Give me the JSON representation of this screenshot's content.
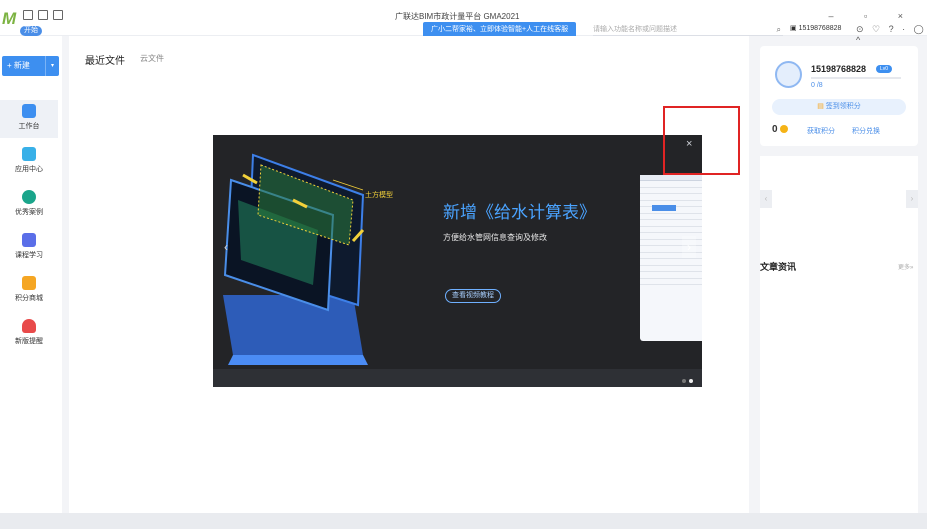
{
  "titlebar": {
    "logo_badge": "开始",
    "app_title": "广联达BIM市政计量平台 GMA2021",
    "promo": "广小二帮家裕、立即体验智能+人工在线客服",
    "search_placeholder": "请输入功能名称或问题描述",
    "user_phone": "15198768828",
    "window_controls": "– ▫ ×",
    "tool_icons": "⊙ ♡ ? · ◯ ^"
  },
  "sidebar": {
    "new_label": "+ 新建",
    "new_arrow": "▾",
    "items": [
      {
        "label": "工作台"
      },
      {
        "label": "应用中心"
      },
      {
        "label": "优秀案例"
      },
      {
        "label": "课程学习"
      },
      {
        "label": "积分商城"
      },
      {
        "label": "新版提醒"
      }
    ]
  },
  "main": {
    "tab_recent": "最近文件",
    "tab_cloud": "云文件"
  },
  "modal": {
    "close": "×",
    "headline": "新增《给水计算表》",
    "subline": "方便给水管网信息查询及修改",
    "watch_button": "查看视频教程",
    "earth_label": "土方模型",
    "prev": "‹",
    "next": "›"
  },
  "right_panel": {
    "username": "15198768828",
    "level": "Lv0",
    "progress_text": "0 /8",
    "progress_fraction": 0,
    "signin": "签到领积分",
    "points": "0",
    "get_points": "获取积分",
    "redeem_points": "积分兑换",
    "news_title": "文章资讯",
    "news_more": "更多»",
    "carousel_left": "‹",
    "carousel_right": "›"
  },
  "colors": {
    "accent": "#3d8ff0",
    "highlight_box": "#e02424",
    "modal_bg": "#232427",
    "headline": "#4aa3ff"
  }
}
